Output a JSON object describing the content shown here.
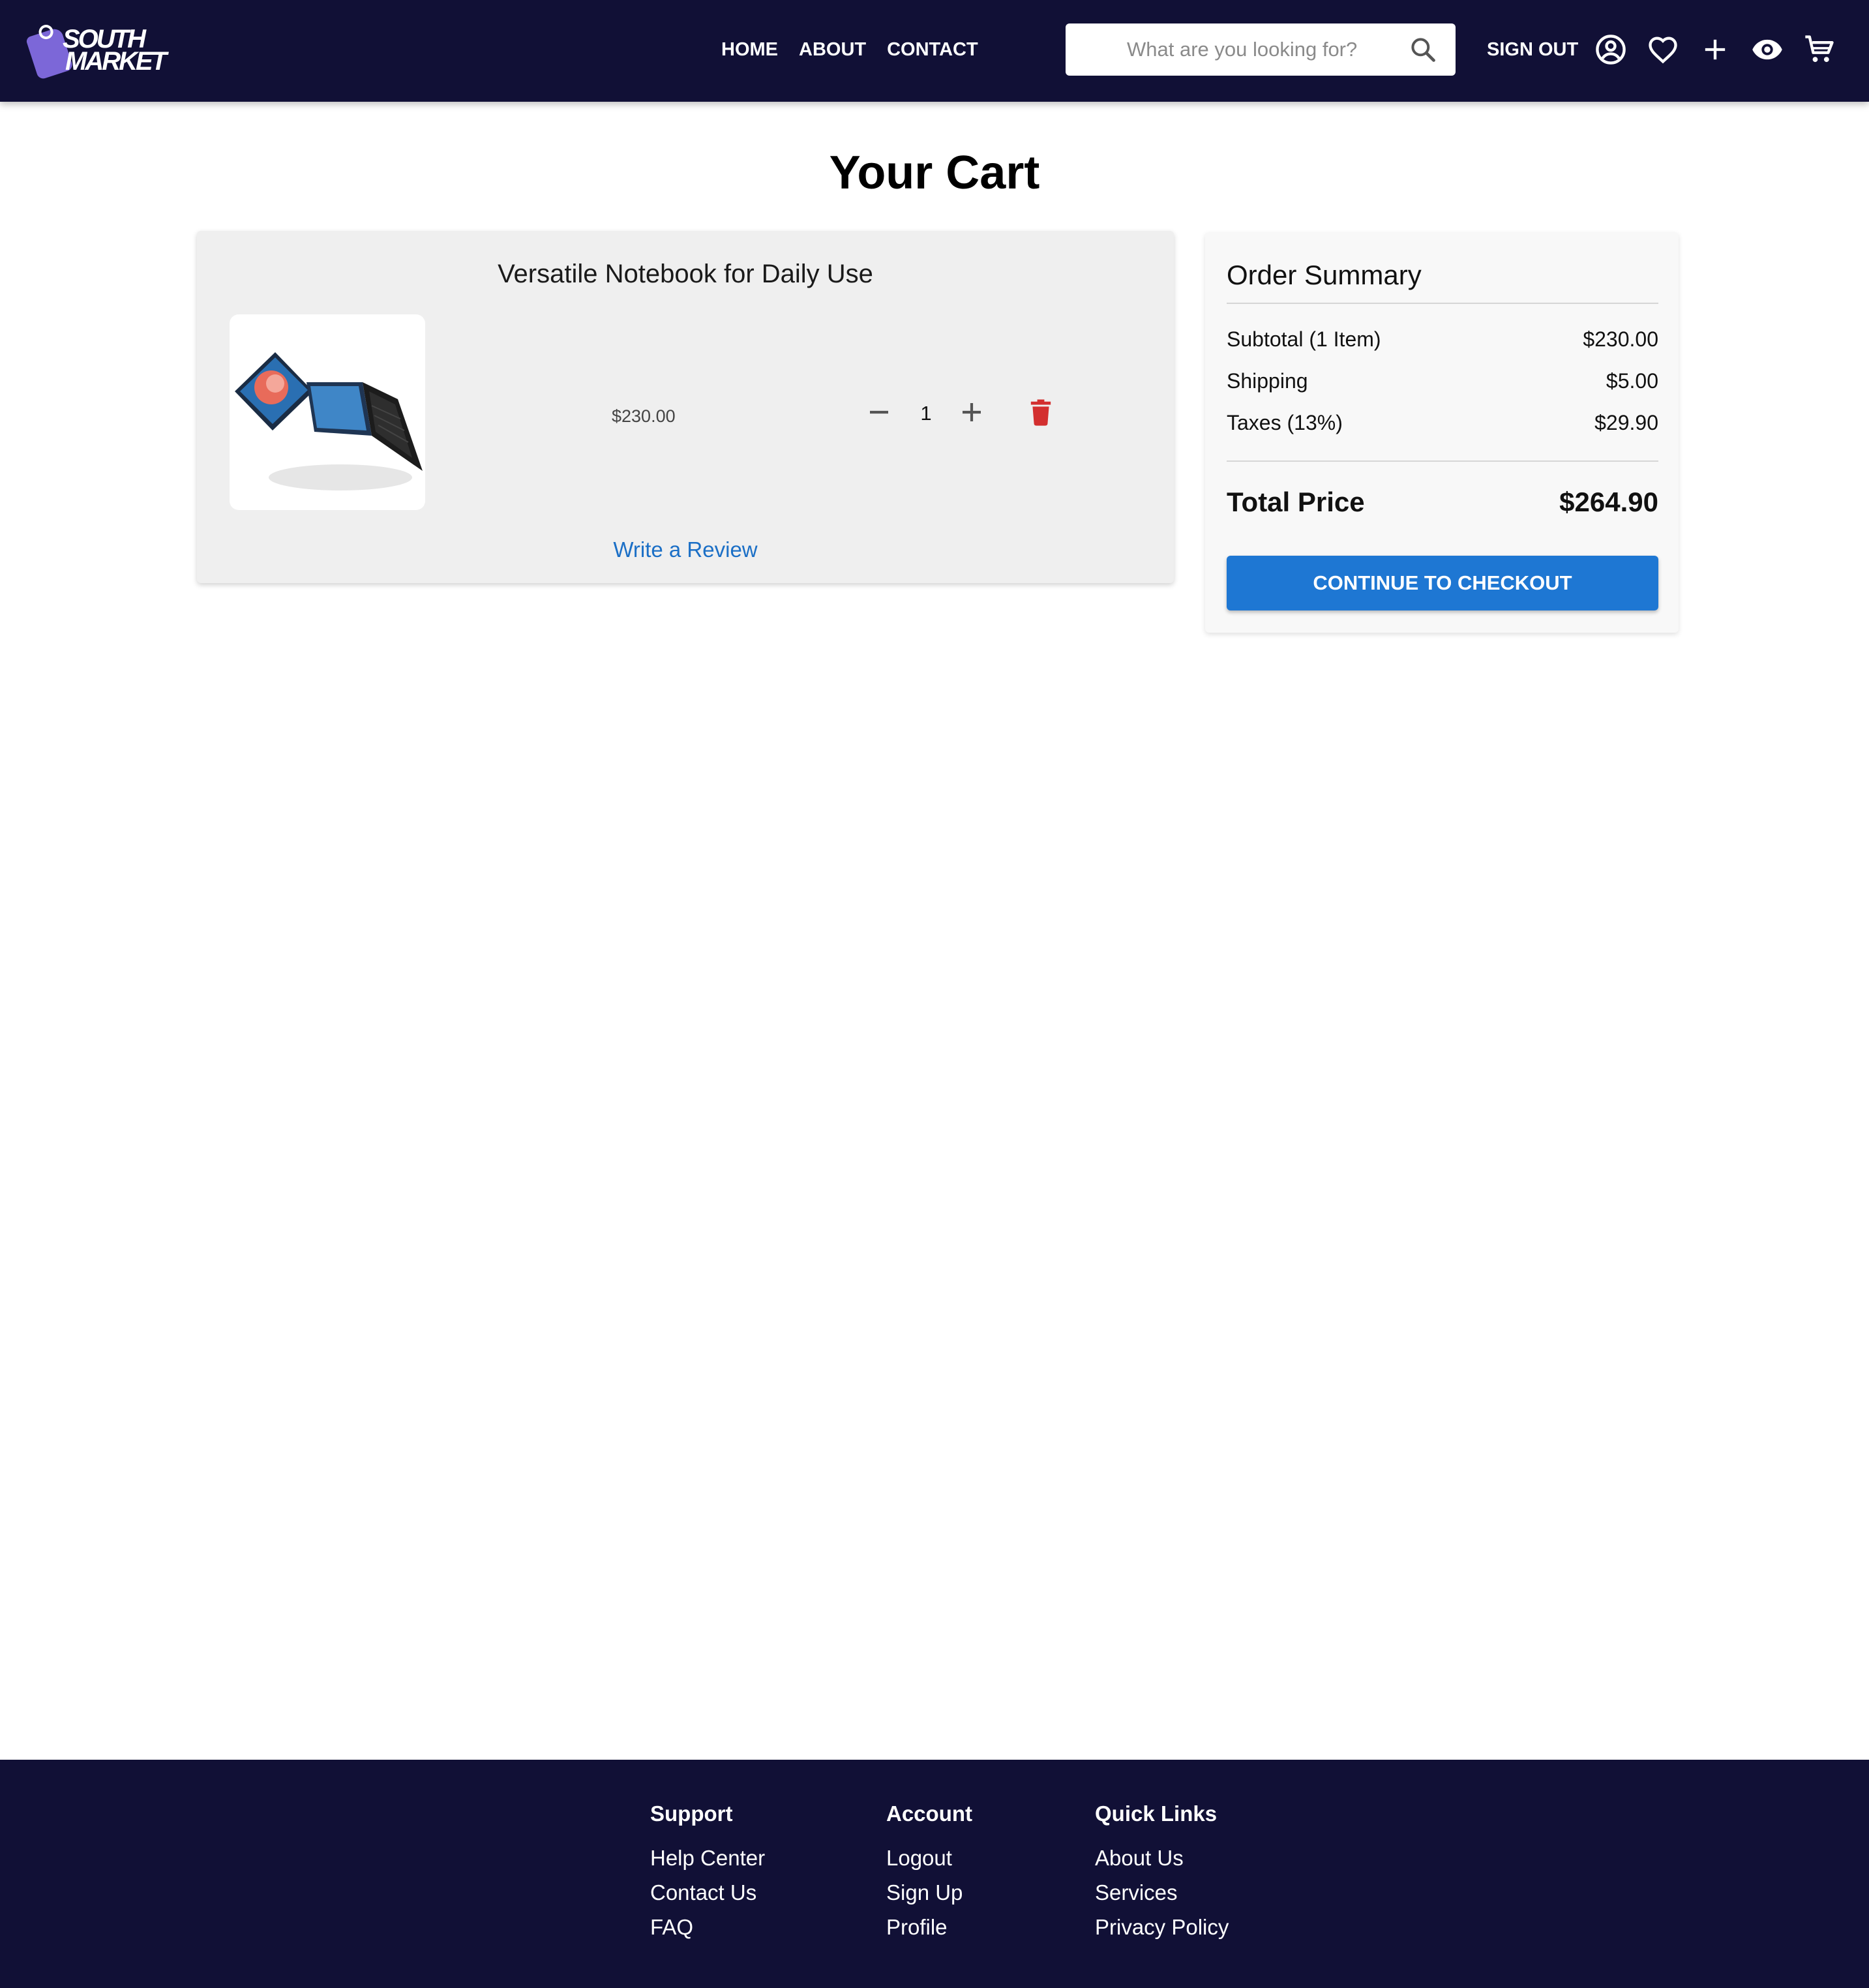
{
  "header": {
    "logo": {
      "line1": "SOUTH",
      "line2": "MARKET"
    },
    "nav": [
      "HOME",
      "ABOUT",
      "CONTACT"
    ],
    "search": {
      "placeholder": "What are you looking for?",
      "value": ""
    },
    "sign_out": "SIGN OUT",
    "icons": [
      "account-circle-icon",
      "heart-icon",
      "plus-icon",
      "eye-icon",
      "cart-icon"
    ]
  },
  "page": {
    "title": "Your Cart"
  },
  "cart": {
    "items": [
      {
        "title": "Versatile Notebook for Daily Use",
        "price": "$230.00",
        "quantity": "1",
        "review_label": "Write a Review"
      }
    ]
  },
  "summary": {
    "title": "Order Summary",
    "rows": [
      {
        "label": "Subtotal (1 Item)",
        "value": "$230.00"
      },
      {
        "label": "Shipping",
        "value": "$5.00"
      },
      {
        "label": "Taxes (13%)",
        "value": "$29.90"
      }
    ],
    "total_label": "Total Price",
    "total_value": "$264.90",
    "checkout_label": "CONTINUE TO CHECKOUT"
  },
  "footer": {
    "columns": [
      {
        "heading": "Support",
        "links": [
          "Help Center",
          "Contact Us",
          "FAQ"
        ]
      },
      {
        "heading": "Account",
        "links": [
          "Logout",
          "Sign Up",
          "Profile"
        ]
      },
      {
        "heading": "Quick Links",
        "links": [
          "About Us",
          "Services",
          "Privacy Policy"
        ]
      }
    ]
  },
  "colors": {
    "header_bg": "#111036",
    "accent_blue": "#1e77d3",
    "link_blue": "#1b6fc6",
    "delete_red": "#d32f2f",
    "logo_purple": "#7c67d8"
  }
}
